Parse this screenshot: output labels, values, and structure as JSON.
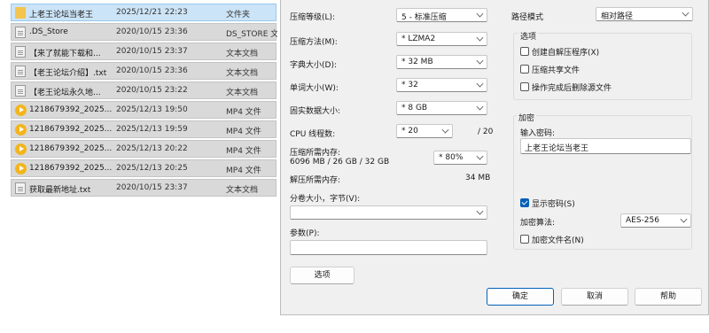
{
  "files": [
    {
      "name": "上老王论坛当老王",
      "date": "2025/12/21 22:23",
      "type": "文件夹",
      "icon": "folder-icon",
      "selected": true
    },
    {
      "name": ".DS_Store",
      "date": "2020/10/15 23:36",
      "type": "DS_STORE 文件",
      "icon": "file-icon"
    },
    {
      "name": "【来了就能下载和...",
      "date": "2020/10/15 23:37",
      "type": "文本文档",
      "icon": "text-file-icon"
    },
    {
      "name": "【老王论坛介绍】.txt",
      "date": "2020/10/15 23:36",
      "type": "文本文档",
      "icon": "text-file-icon"
    },
    {
      "name": "【老王论坛永久地...",
      "date": "2020/10/15 23:22",
      "type": "文本文档",
      "icon": "text-file-icon"
    },
    {
      "name": "1218679392_2025...",
      "date": "2025/12/13 19:50",
      "type": "MP4 文件",
      "icon": "video-file-icon"
    },
    {
      "name": "1218679392_2025...",
      "date": "2025/12/13 19:59",
      "type": "MP4 文件",
      "icon": "video-file-icon"
    },
    {
      "name": "1218679392_2025...",
      "date": "2025/12/13 20:22",
      "type": "MP4 文件",
      "icon": "video-file-icon"
    },
    {
      "name": "1218679392_2025...",
      "date": "2025/12/13 20:25",
      "type": "MP4 文件",
      "icon": "video-file-icon"
    },
    {
      "name": "获取最新地址.txt",
      "date": "2020/10/15 23:37",
      "type": "文本文档",
      "icon": "text-file-icon"
    }
  ],
  "dialog": {
    "compression_level_label": "压缩等级(L):",
    "compression_level_value": "5 - 标准压缩",
    "compression_method_label": "压缩方法(M):",
    "compression_method_value": "* LZMA2",
    "dictionary_size_label": "字典大小(D):",
    "dictionary_size_value": "* 32 MB",
    "word_size_label": "单词大小(W):",
    "word_size_value": "* 32",
    "solid_block_label": "固实数据大小:",
    "solid_block_value": "* 8 GB",
    "cpu_threads_label": "CPU 线程数:",
    "cpu_threads_value": "* 20",
    "cpu_threads_total": "/ 20",
    "memory_compress_label": "压缩所需内存:",
    "memory_compress_detail": "6096 MB / 26 GB / 32 GB",
    "memory_percent_value": "* 80%",
    "memory_decompress_label": "解压所需内存:",
    "memory_decompress_value": "34 MB",
    "split_label": "分卷大小，字节(V):",
    "split_value": "",
    "params_label": "参数(P):",
    "params_value": "",
    "options_button": "选项",
    "path_mode_label": "路径模式",
    "path_mode_value": "相对路径",
    "options_group_title": "选项",
    "opt_sfx": "创建自解压程序(X)",
    "opt_shared": "压缩共享文件",
    "opt_delete": "操作完成后删除源文件",
    "encryption_group_title": "加密",
    "password_label": "输入密码:",
    "password_value": "上老王论坛当老王",
    "show_password": "显示密码(S)",
    "encryption_method_label": "加密算法:",
    "encryption_method_value": "AES-256",
    "encrypt_names": "加密文件名(N)",
    "ok_button": "确定",
    "cancel_button": "取消",
    "help_button": "帮助"
  },
  "colors": {
    "accent": "#005fb8",
    "selection": "#cce4f7"
  }
}
